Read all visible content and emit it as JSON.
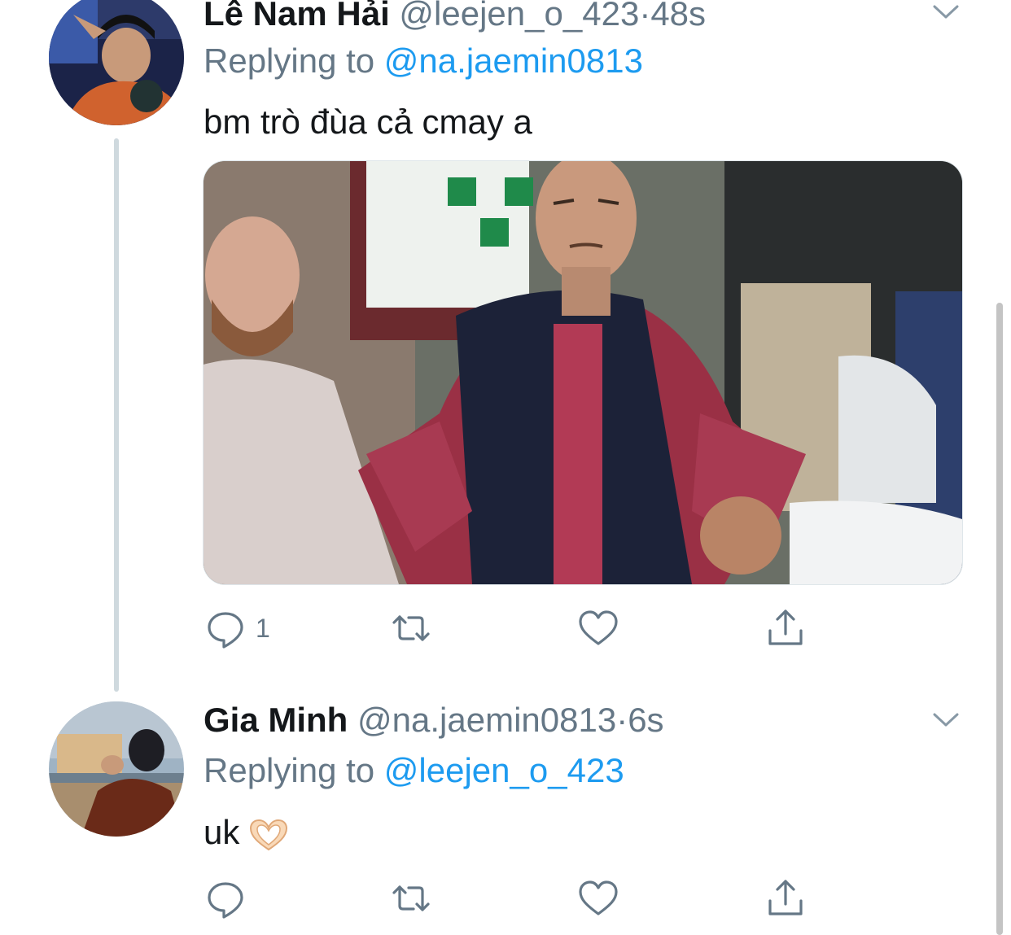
{
  "tweets": [
    {
      "name": "Lê Nam Hải",
      "handle": "@leejen_o_423",
      "separator": "·",
      "time": "48s",
      "replying_prefix": "Replying to",
      "replying_to": "@na.jaemin0813",
      "text": "bm trò đùa cả cmay a",
      "avatar": "avatar-photo",
      "media": "meme-photo",
      "actions": {
        "reply_count": "1",
        "retweet_count": "",
        "like_count": ""
      }
    },
    {
      "name": "Gia Minh",
      "handle": "@na.jaemin0813",
      "separator": "·",
      "time": "6s",
      "replying_prefix": "Replying to",
      "replying_to": "@leejen_o_423",
      "text": "uk",
      "emoji": "heart-hands",
      "avatar": "avatar-photo",
      "actions": {
        "reply_count": "",
        "retweet_count": "",
        "like_count": ""
      }
    }
  ],
  "icons": {
    "reply": "reply-icon",
    "retweet": "retweet-icon",
    "like": "heart-icon",
    "share": "share-icon",
    "menu": "chevron-down-icon"
  },
  "colors": {
    "accent": "#1d9bf0",
    "muted": "#657786",
    "text": "#14171a"
  }
}
